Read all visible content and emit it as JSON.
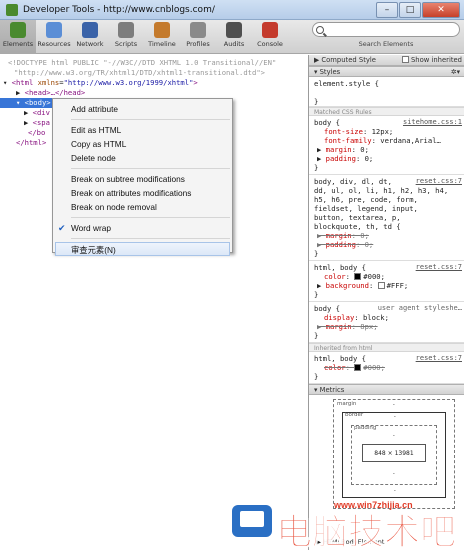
{
  "window": {
    "title": "Developer Tools - http://www.cnblogs.com/",
    "min": "–",
    "max": "□",
    "close": "✕"
  },
  "toolbar": {
    "tools": [
      {
        "label": "Elements",
        "icon": "elements-icon",
        "color": "#4a8a2e"
      },
      {
        "label": "Resources",
        "icon": "resources-icon",
        "color": "#5b8ed6"
      },
      {
        "label": "Network",
        "icon": "network-icon",
        "color": "#3b63a8"
      },
      {
        "label": "Scripts",
        "icon": "scripts-icon",
        "color": "#7d7d7d"
      },
      {
        "label": "Timeline",
        "icon": "timeline-icon",
        "color": "#c47a2c"
      },
      {
        "label": "Profiles",
        "icon": "profiles-icon",
        "color": "#8a8a8a"
      },
      {
        "label": "Audits",
        "icon": "audits-icon",
        "color": "#4f4f4f"
      },
      {
        "label": "Console",
        "icon": "console-icon",
        "color": "#c43a2c"
      }
    ],
    "search": {
      "placeholder": "",
      "value": "",
      "label": "Search Elements"
    }
  },
  "dom": {
    "doctype": "<!DOCTYPE html PUBLIC \"-//W3C//DTD XHTML 1.0 Transitional//EN\"",
    "doctype2": "\"http://www.w3.org/TR/xhtml1/DTD/xhtml1-transitional.dtd\">",
    "html_open_tag": "<html",
    "html_attr": "xmlns",
    "html_val": "\"http://www.w3.org/1999/xhtml\"",
    "html_close_bracket": ">",
    "head": "<head>…</head>",
    "body": "<body>",
    "div": "<div",
    "span": "<spa",
    "body_close": "</bo",
    "html_close": "</html>"
  },
  "context_menu": {
    "add_attribute": "Add attribute",
    "edit_as_html": "Edit as HTML",
    "copy_as_html": "Copy as HTML",
    "delete_node": "Delete node",
    "break_subtree": "Break on subtree modifications",
    "break_attributes": "Break on attributes modifications",
    "break_removal": "Break on node removal",
    "word_wrap": "Word wrap",
    "inspect": "审查元素(N)"
  },
  "sidebar": {
    "computed_style": "Computed Style",
    "show_inherited": "Show inherited",
    "styles": "Styles",
    "element_style": "element.style {",
    "close_brace": "}",
    "matched_rules": "Matched CSS Rules",
    "inherited_from": "Inherited from html",
    "metrics": "Metrics",
    "rules": [
      {
        "selector": "body {",
        "source": "sitehome.css:1",
        "props": [
          {
            "name": "font-size",
            "value": "12px;",
            "struck": false
          },
          {
            "name": "font-family",
            "value": "verdana,Arial…",
            "struck": false
          },
          {
            "name": "margin",
            "value": "0;",
            "struck": false
          },
          {
            "name": "padding",
            "value": "0;",
            "struck": false
          }
        ]
      },
      {
        "selector": "body, div, dl, dt,",
        "source": "reset.css:7",
        "selector_more": [
          "dd, ul, ol, li, h1, h2, h3, h4,",
          "h5, h6, pre, code, form,",
          "fieldset, legend, input,",
          "button, textarea, p,",
          "blockquote, th, td {"
        ],
        "props": [
          {
            "name": "margin",
            "value": "0;",
            "struck": true
          },
          {
            "name": "padding",
            "value": "0;",
            "struck": true
          }
        ]
      },
      {
        "selector": "html, body {",
        "source": "reset.css:7",
        "props": [
          {
            "name": "color",
            "value": "#000;",
            "struck": false,
            "swatch": "#000000"
          },
          {
            "name": "background",
            "value": "#FFF;",
            "struck": false,
            "swatch": "#ffffff"
          }
        ]
      },
      {
        "selector": "body {",
        "source": "user agent styleshe…",
        "props": [
          {
            "name": "display",
            "value": "block;",
            "struck": false
          },
          {
            "name": "margin",
            "value": "8px;",
            "struck": true
          }
        ]
      }
    ],
    "inherited_rule": {
      "selector": "html, body {",
      "source": "reset.css:7",
      "prop": {
        "name": "color",
        "value": "#000;",
        "swatch": "#000000"
      }
    },
    "box": {
      "margin_label": "margin",
      "border_label": "border",
      "padding_label": "padding",
      "content": "848 × 13981",
      "dash": "-"
    },
    "breadcrumb": "▶ HTMLBodyElement"
  },
  "watermark": {
    "url": "www.win7zhijia.cn",
    "text": "电脑技术吧",
    "color": "#e8452f"
  }
}
